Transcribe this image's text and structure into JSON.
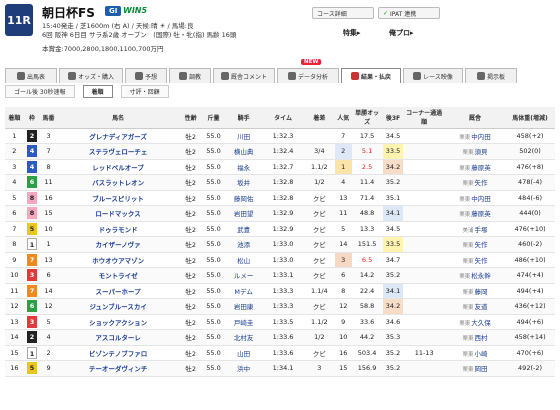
{
  "race": {
    "number": "11R",
    "name": "朝日杯FS",
    "grade": "GI",
    "win5": "WIN5",
    "info_line": "15:40発走 / 芝1600m (右 A) / 天候:晴 ☀ / 馬場:良",
    "info_line2": "6回 阪神 6日目 サラ系2歳 オープン　(国際) 牡・牝(指) 馬齢 16頭",
    "prize": "本賞金:7000,2800,1800,1100,700万円"
  },
  "header_buttons": {
    "course": "コース詳細",
    "ipat_mark": "✓",
    "ipat": "IPAT 連携"
  },
  "links": {
    "special": "特集▸",
    "points": "俺プロ▸"
  },
  "tabs": [
    {
      "label": "出馬表"
    },
    {
      "label": "オッズ・購入"
    },
    {
      "label": "予想"
    },
    {
      "label": "調教"
    },
    {
      "label": "厩舎コメント"
    },
    {
      "label": "データ分析"
    },
    {
      "label": "結果・払戻"
    },
    {
      "label": "レース映像"
    },
    {
      "label": "掲示板"
    }
  ],
  "new_flag": "NEW",
  "subtabs": [
    {
      "label": "ゴール後 30秒速報"
    },
    {
      "label": "着順"
    },
    {
      "label": "寸評・回顧"
    }
  ],
  "columns": [
    "着順",
    "枠",
    "馬番",
    "馬名",
    "性齢",
    "斤量",
    "騎手",
    "タイム",
    "着差",
    "人気",
    "単勝オッズ",
    "後3F",
    "コーナー通過順",
    "厩舎",
    "馬体重(増減)"
  ],
  "rows": [
    {
      "rank": "1",
      "waku": "2",
      "num": "3",
      "name": "グレナディアガーズ",
      "sex": "牡2",
      "kin": "55.0",
      "jockey": "川田",
      "time": "1:32.3",
      "diff": "",
      "pop": "7",
      "odds": "17.5",
      "last3": "34.5",
      "corner": "",
      "region": "栗東",
      "trainer": "中内田",
      "weight": "458(+2)"
    },
    {
      "rank": "2",
      "waku": "4",
      "num": "7",
      "name": "ステラヴェローチェ",
      "sex": "牡2",
      "kin": "55.0",
      "jockey": "横山典",
      "time": "1:32.4",
      "diff": "3/4",
      "pop": "2",
      "odds": "5.1",
      "last3": "33.5",
      "corner": "",
      "region": "栗東",
      "trainer": "須貝",
      "weight": "502(0)"
    },
    {
      "rank": "3",
      "waku": "4",
      "num": "8",
      "name": "レッドベルオーブ",
      "sex": "牡2",
      "kin": "55.0",
      "jockey": "福永",
      "time": "1:32.7",
      "diff": "1.1/2",
      "pop": "1",
      "odds": "2.5",
      "last3": "34.2",
      "corner": "",
      "region": "栗東",
      "trainer": "藤原英",
      "weight": "476(+8)"
    },
    {
      "rank": "4",
      "waku": "6",
      "num": "11",
      "name": "バスラットレオン",
      "sex": "牡2",
      "kin": "55.0",
      "jockey": "坂井",
      "time": "1:32.8",
      "diff": "1/2",
      "pop": "4",
      "odds": "11.4",
      "last3": "35.2",
      "corner": "",
      "region": "栗東",
      "trainer": "矢作",
      "weight": "478(-4)"
    },
    {
      "rank": "5",
      "waku": "8",
      "num": "16",
      "name": "ブルースピリット",
      "sex": "牡2",
      "kin": "55.0",
      "jockey": "藤岡佑",
      "time": "1:32.8",
      "diff": "クビ",
      "pop": "13",
      "odds": "71.4",
      "last3": "35.1",
      "corner": "",
      "region": "栗東",
      "trainer": "中内田",
      "weight": "484(-6)"
    },
    {
      "rank": "6",
      "waku": "8",
      "num": "15",
      "name": "ロードマックス",
      "sex": "牡2",
      "kin": "55.0",
      "jockey": "岩田望",
      "time": "1:32.9",
      "diff": "クビ",
      "pop": "11",
      "odds": "48.8",
      "last3": "34.1",
      "corner": "",
      "region": "栗東",
      "trainer": "藤原英",
      "weight": "444(0)"
    },
    {
      "rank": "7",
      "waku": "5",
      "num": "10",
      "name": "ドゥラモンド",
      "sex": "牡2",
      "kin": "55.0",
      "jockey": "武豊",
      "time": "1:32.9",
      "diff": "クビ",
      "pop": "5",
      "odds": "13.3",
      "last3": "34.5",
      "corner": "",
      "region": "美浦",
      "trainer": "手塚",
      "weight": "476(+10)"
    },
    {
      "rank": "8",
      "waku": "1",
      "num": "1",
      "name": "カイザーノヴァ",
      "sex": "牡2",
      "kin": "55.0",
      "jockey": "池添",
      "time": "1:33.0",
      "diff": "クビ",
      "pop": "14",
      "odds": "151.5",
      "last3": "33.5",
      "corner": "",
      "region": "栗東",
      "trainer": "矢作",
      "weight": "460(-2)"
    },
    {
      "rank": "9",
      "waku": "7",
      "num": "13",
      "name": "ホウオウアマゾン",
      "sex": "牡2",
      "kin": "55.0",
      "jockey": "松山",
      "time": "1:33.0",
      "diff": "クビ",
      "pop": "3",
      "odds": "6.5",
      "last3": "34.7",
      "corner": "",
      "region": "栗東",
      "trainer": "矢作",
      "weight": "486(+10)"
    },
    {
      "rank": "10",
      "waku": "3",
      "num": "6",
      "name": "モントライゼ",
      "sex": "牡2",
      "kin": "55.0",
      "jockey": "ルメー",
      "time": "1:33.1",
      "diff": "クビ",
      "pop": "6",
      "odds": "14.2",
      "last3": "35.2",
      "corner": "",
      "region": "栗東",
      "trainer": "松永幹",
      "weight": "474(+4)"
    },
    {
      "rank": "11",
      "waku": "7",
      "num": "14",
      "name": "スーパーホープ",
      "sex": "牡2",
      "kin": "55.0",
      "jockey": "Mデム",
      "time": "1:33.3",
      "diff": "1.1/4",
      "pop": "8",
      "odds": "22.4",
      "last3": "34.1",
      "corner": "",
      "region": "栗東",
      "trainer": "藤岡",
      "weight": "494(+4)"
    },
    {
      "rank": "12",
      "waku": "6",
      "num": "12",
      "name": "ジュンブルースカイ",
      "sex": "牡2",
      "kin": "55.0",
      "jockey": "岩田康",
      "time": "1:33.3",
      "diff": "クビ",
      "pop": "12",
      "odds": "58.8",
      "last3": "34.2",
      "corner": "",
      "region": "栗東",
      "trainer": "友道",
      "weight": "436(+12)"
    },
    {
      "rank": "13",
      "waku": "3",
      "num": "5",
      "name": "ショックアクション",
      "sex": "牡2",
      "kin": "55.0",
      "jockey": "戸崎圭",
      "time": "1:33.5",
      "diff": "1.1/2",
      "pop": "9",
      "odds": "33.6",
      "last3": "34.6",
      "corner": "",
      "region": "栗東",
      "trainer": "大久保",
      "weight": "494(+6)"
    },
    {
      "rank": "14",
      "waku": "2",
      "num": "4",
      "name": "アスコルターレ",
      "sex": "牡2",
      "kin": "55.0",
      "jockey": "北村友",
      "time": "1:33.6",
      "diff": "1/2",
      "pop": "10",
      "odds": "44.2",
      "last3": "35.3",
      "corner": "",
      "region": "栗東",
      "trainer": "西村",
      "weight": "458(+14)"
    },
    {
      "rank": "15",
      "waku": "1",
      "num": "2",
      "name": "ビゾンテノブファロ",
      "sex": "牡2",
      "kin": "55.0",
      "jockey": "山田",
      "time": "1:33.6",
      "diff": "クビ",
      "pop": "16",
      "odds": "503.4",
      "last3": "35.2",
      "corner": "11-13",
      "region": "栗東",
      "trainer": "小崎",
      "weight": "470(+6)"
    },
    {
      "rank": "16",
      "waku": "5",
      "num": "9",
      "name": "テーオーダヴィンチ",
      "sex": "牡2",
      "kin": "55.0",
      "jockey": "浜中",
      "time": "1:34.1",
      "diff": "3",
      "pop": "15",
      "odds": "156.9",
      "last3": "35.2",
      "corner": "",
      "region": "栗東",
      "trainer": "岡田",
      "weight": "492(-2)"
    }
  ],
  "waku_colors": {
    "1": "#ffffff",
    "2": "#222222",
    "3": "#e03a3a",
    "4": "#2a5bc4",
    "5": "#e8c81e",
    "6": "#2f9e44",
    "7": "#f08a1e",
    "8": "#f4a8c0"
  }
}
